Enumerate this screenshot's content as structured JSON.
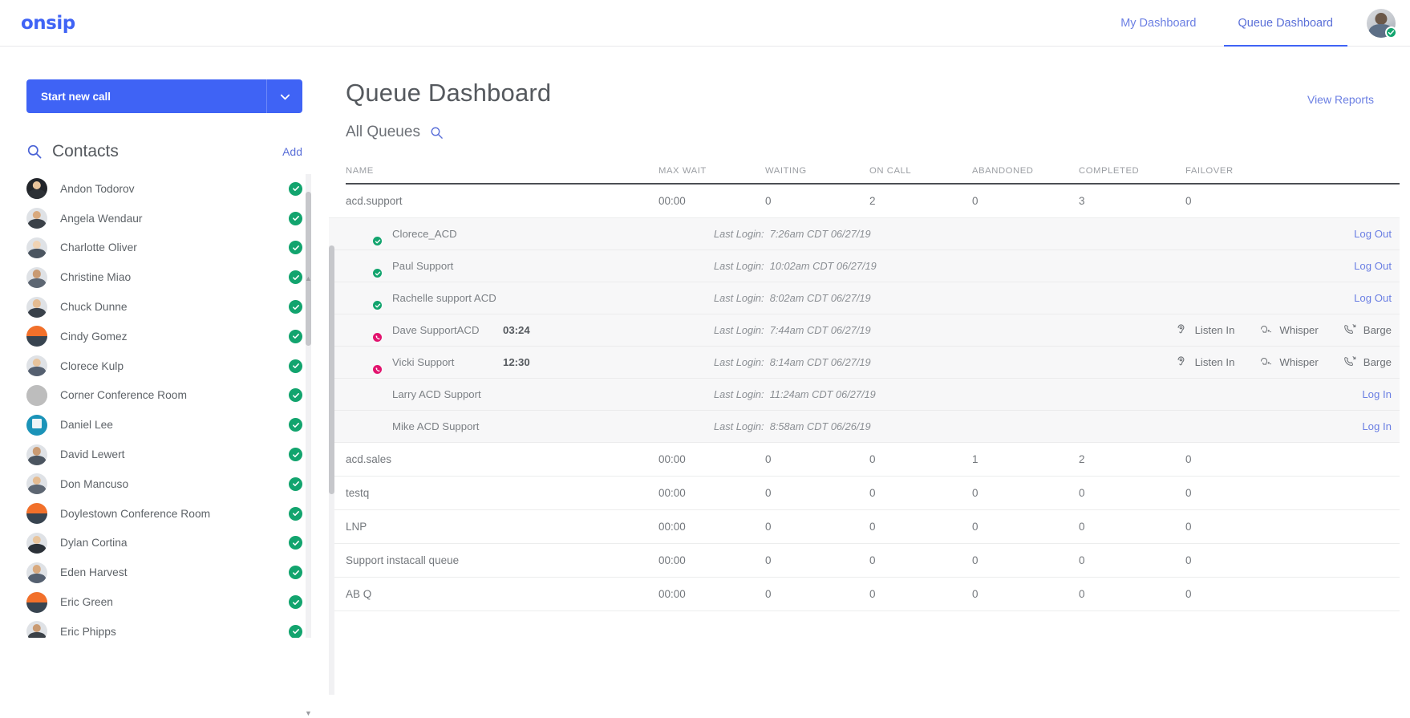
{
  "app": {
    "logo_text": "onsip",
    "brand_color": "#3f63f5"
  },
  "topnav": {
    "tabs": [
      {
        "label": "My Dashboard",
        "active": false
      },
      {
        "label": "Queue Dashboard",
        "active": true
      }
    ],
    "user_avatar_name": "user-avatar",
    "user_status": "available"
  },
  "sidebar": {
    "call_button_label": "Start new call",
    "call_button_caret": "chevron-down-icon",
    "contacts_title": "Contacts",
    "contacts_add_label": "Add",
    "contacts": [
      {
        "name": "Andon Todorov",
        "status": "available",
        "avatar": "photo-dark"
      },
      {
        "name": "Angela Wendaur",
        "status": "available",
        "avatar": "photo-woman"
      },
      {
        "name": "Charlotte Oliver",
        "status": "available",
        "avatar": "photo-woman2"
      },
      {
        "name": "Christine Miao",
        "status": "available",
        "avatar": "photo-woman3"
      },
      {
        "name": "Chuck Dunne",
        "status": "available",
        "avatar": "photo-man"
      },
      {
        "name": "Cindy Gomez",
        "status": "available",
        "avatar": "pie-orange"
      },
      {
        "name": "Clorece Kulp",
        "status": "available",
        "avatar": "photo-woman4"
      },
      {
        "name": "Corner Conference Room",
        "status": "available",
        "avatar": "pie-grey"
      },
      {
        "name": "Daniel Lee",
        "status": "available",
        "avatar": "teal-logo"
      },
      {
        "name": "David Lewert",
        "status": "available",
        "avatar": "photo-man2"
      },
      {
        "name": "Don Mancuso",
        "status": "available",
        "avatar": "photo-man3"
      },
      {
        "name": "Doylestown Conference Room",
        "status": "available",
        "avatar": "pie-orange"
      },
      {
        "name": "Dylan Cortina",
        "status": "available",
        "avatar": "photo-man4"
      },
      {
        "name": "Eden Harvest",
        "status": "available",
        "avatar": "photo-man5"
      },
      {
        "name": "Eric Green",
        "status": "available",
        "avatar": "pie-orange"
      },
      {
        "name": "Eric Phipps",
        "status": "available",
        "avatar": "photo-man6"
      }
    ]
  },
  "main": {
    "page_title": "Queue Dashboard",
    "view_reports_label": "View Reports",
    "queue_filter_label": "All Queues",
    "queue_filter_icon": "search-icon",
    "table": {
      "columns": [
        "NAME",
        "MAX WAIT",
        "WAITING",
        "ON CALL",
        "ABANDONED",
        "COMPLETED",
        "FAILOVER"
      ],
      "rows": [
        {
          "type": "queue",
          "name": "acd.support",
          "max_wait": "00:00",
          "waiting": "0",
          "on_call": "2",
          "abandoned": "0",
          "completed": "3",
          "failover": "0",
          "expanded": true,
          "agents": [
            {
              "name": "Clorece_ACD",
              "timer": "",
              "status": "available",
              "last_login_label": "Last Login:",
              "last_login_value": "7:26am CDT 06/27/19",
              "action_link": "Log Out",
              "actions": []
            },
            {
              "name": "Paul Support",
              "timer": "",
              "status": "available",
              "last_login_label": "Last Login:",
              "last_login_value": "10:02am CDT 06/27/19",
              "action_link": "Log Out",
              "actions": []
            },
            {
              "name": "Rachelle support ACD",
              "timer": "",
              "status": "available",
              "last_login_label": "Last Login:",
              "last_login_value": "8:02am CDT 06/27/19",
              "action_link": "Log Out",
              "actions": []
            },
            {
              "name": "Dave SupportACD",
              "timer": "03:24",
              "status": "on-call",
              "last_login_label": "Last Login:",
              "last_login_value": "7:44am CDT 06/27/19",
              "action_link": "",
              "actions": [
                "Listen In",
                "Whisper",
                "Barge"
              ]
            },
            {
              "name": "Vicki Support",
              "timer": "12:30",
              "status": "on-call",
              "last_login_label": "Last Login:",
              "last_login_value": "8:14am CDT 06/27/19",
              "action_link": "",
              "actions": [
                "Listen In",
                "Whisper",
                "Barge"
              ]
            },
            {
              "name": "Larry ACD Support",
              "timer": "",
              "status": "offline",
              "last_login_label": "Last Login:",
              "last_login_value": "11:24am CDT 06/27/19",
              "action_link": "Log In",
              "actions": []
            },
            {
              "name": "Mike ACD Support",
              "timer": "",
              "status": "offline",
              "last_login_label": "Last Login:",
              "last_login_value": "8:58am CDT 06/26/19",
              "action_link": "Log In",
              "actions": []
            }
          ]
        },
        {
          "type": "queue",
          "name": "acd.sales",
          "max_wait": "00:00",
          "waiting": "0",
          "on_call": "0",
          "abandoned": "1",
          "completed": "2",
          "failover": "0",
          "expanded": false,
          "agents": []
        },
        {
          "type": "queue",
          "name": "testq",
          "max_wait": "00:00",
          "waiting": "0",
          "on_call": "0",
          "abandoned": "0",
          "completed": "0",
          "failover": "0",
          "expanded": false,
          "agents": []
        },
        {
          "type": "queue",
          "name": "LNP",
          "max_wait": "00:00",
          "waiting": "0",
          "on_call": "0",
          "abandoned": "0",
          "completed": "0",
          "failover": "0",
          "expanded": false,
          "agents": []
        },
        {
          "type": "queue",
          "name": "Support instacall queue",
          "max_wait": "00:00",
          "waiting": "0",
          "on_call": "0",
          "abandoned": "0",
          "completed": "0",
          "failover": "0",
          "expanded": false,
          "agents": []
        },
        {
          "type": "queue",
          "name": "AB Q",
          "max_wait": "00:00",
          "waiting": "0",
          "on_call": "0",
          "abandoned": "0",
          "completed": "0",
          "failover": "0",
          "expanded": false,
          "agents": []
        }
      ]
    }
  }
}
